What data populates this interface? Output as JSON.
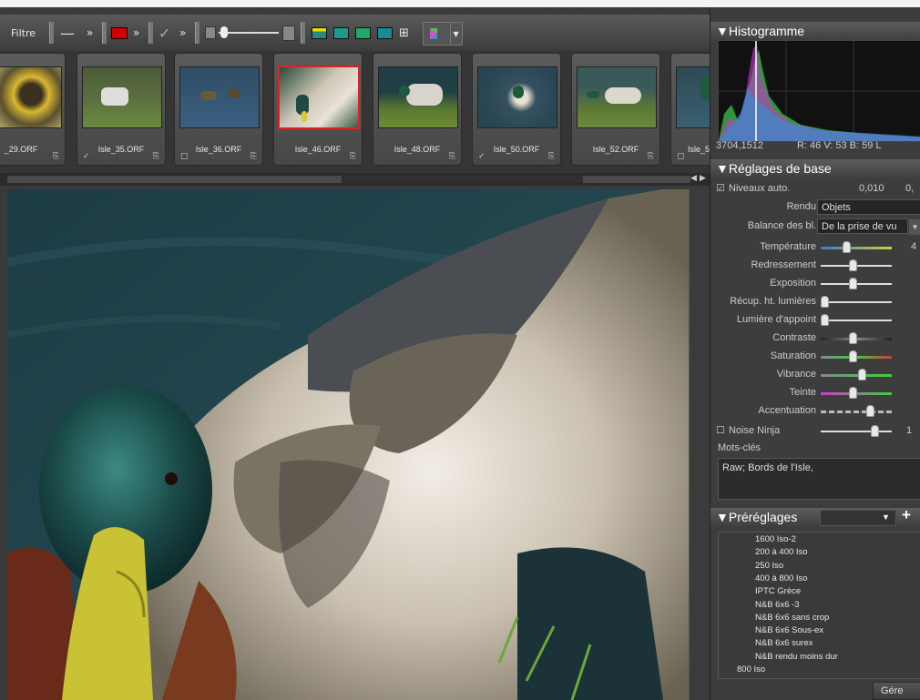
{
  "toolbar": {
    "filter_label": "Filtre",
    "more_label": "»",
    "line_icon": "minus-icon",
    "color_label_color": "#d40000",
    "check_icon": "check-icon",
    "accent_color": "#e8e8e8"
  },
  "filmstrip": {
    "items": [
      {
        "name": "_29.ORF",
        "mark": ""
      },
      {
        "name": "Isle_35.ORF",
        "mark": "✓"
      },
      {
        "name": "Isle_36.ORF",
        "mark": ""
      },
      {
        "name": "Isle_46.ORF",
        "mark": ""
      },
      {
        "name": "Isle_48.ORF",
        "mark": ""
      },
      {
        "name": "Isle_50.ORF",
        "mark": "✓"
      },
      {
        "name": "Isle_52.ORF",
        "mark": ""
      },
      {
        "name": "Isle_5",
        "mark": ""
      }
    ],
    "selected_index": 3,
    "selected_color": "#d22222"
  },
  "histogram": {
    "title": "▼Histogramme",
    "coords": "3704,1512",
    "rgb": "R: 46 V: 53 B: 59 L"
  },
  "basic": {
    "title": "▼Réglages de base",
    "auto_levels_label": "Niveaux auto.",
    "auto_levels_value": "0,010",
    "auto_levels_value2": "0,",
    "rendu_label": "Rendu",
    "rendu_value": "Objets",
    "wb_label": "Balance des bl.",
    "wb_value": "De la prise de vu",
    "sliders": [
      {
        "label": "Température",
        "value": "4",
        "pos": 0.35
      },
      {
        "label": "Redressement",
        "value": "",
        "pos": 0.45
      },
      {
        "label": "Exposition",
        "value": "",
        "pos": 0.45
      },
      {
        "label": "Récup. ht. lumières",
        "value": "",
        "pos": 0.0
      },
      {
        "label": "Lumière d'appoint",
        "value": "",
        "pos": 0.0
      },
      {
        "label": "Contraste",
        "value": "",
        "pos": 0.45
      },
      {
        "label": "Saturation",
        "value": "",
        "pos": 0.45
      },
      {
        "label": "Vibrance",
        "value": "",
        "pos": 0.6
      },
      {
        "label": "Teinte",
        "value": "",
        "pos": 0.45
      },
      {
        "label": "Accentuation",
        "value": "",
        "pos": 0.72
      }
    ],
    "noise_label": "Noise Ninja",
    "noise_value": "1",
    "keywords_label": "Mots-clés",
    "keywords_value": "Raw; Bords de l'Isle,"
  },
  "presets": {
    "title": "▼Préréglages",
    "items": [
      "1600 Iso-2",
      "200 à 400 Iso",
      "250 Iso",
      "400 à 800 Iso",
      "IPTC Grèce",
      "N&B 6x6 -3",
      "N&B 6x6 sans crop",
      "N&B 6x6 Sous-ex",
      "N&B 6x6 surex",
      "N&B rendu moins dur",
      "800 Iso"
    ],
    "manage_label": "Gére"
  }
}
